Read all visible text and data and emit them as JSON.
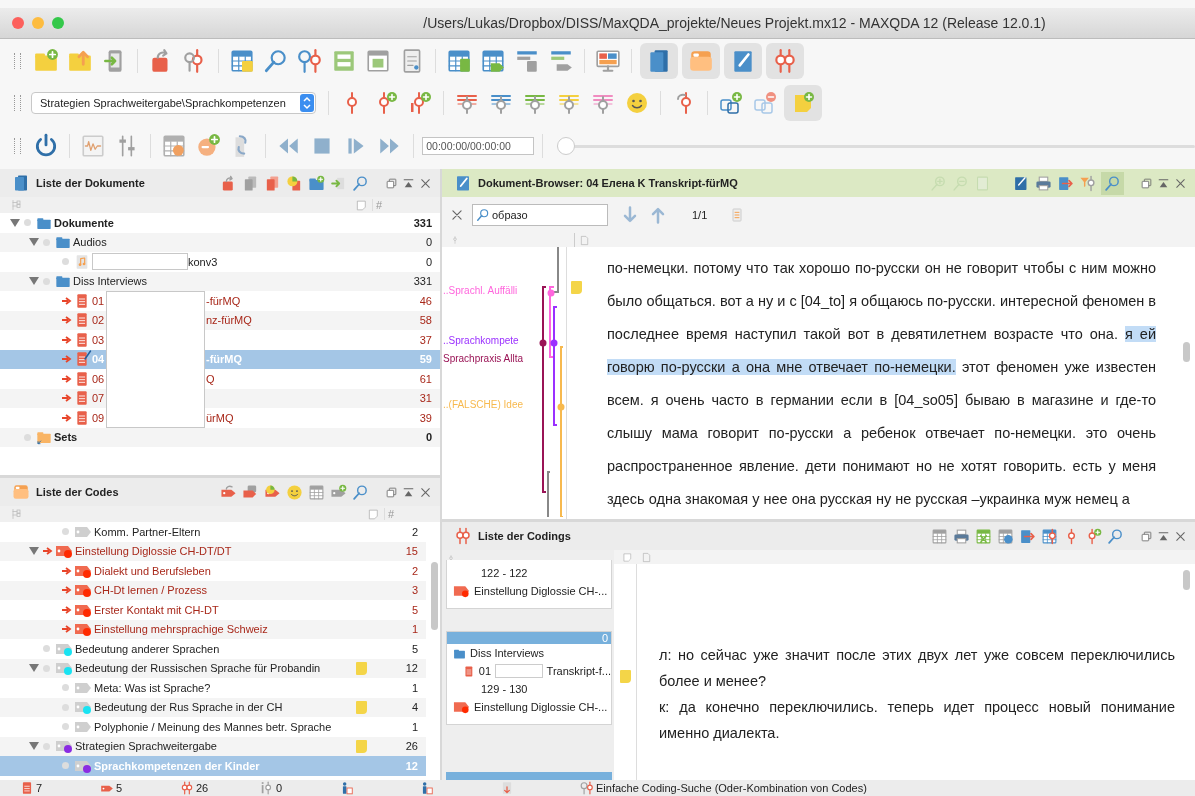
{
  "window": {
    "title": "/Users/Lukas/Dropbox/DISS/MaxQDA_projekte/Neues Projekt.mx12 - MAXQDA 12  (Release 12.0.1)"
  },
  "toolbar": {
    "panel_toggles": [
      {
        "selected": true
      },
      {
        "selected": true
      },
      {
        "selected": true
      },
      {
        "selected": true
      }
    ],
    "code_selector": "Strategien Sprachweitergabe\\Sprachkompetenzen",
    "memo_toggle": {
      "selected": true
    },
    "media_time": "00:00:00/00:00:00",
    "media_position": {
      "level": 0
    }
  },
  "documents": {
    "title": "Liste der Dokumente",
    "count_column": "#",
    "tree": [
      {
        "kind": "folder",
        "label": "Dokumente",
        "count": "331",
        "expanded": true,
        "selected": false,
        "children": [
          {
            "kind": "folder",
            "label": "Audios",
            "count": "0",
            "expanded": true,
            "selected": false,
            "children": [
              {
                "kind": "audio",
                "tail": "konv3",
                "count": "0",
                "selected": false
              }
            ]
          },
          {
            "kind": "folder",
            "label": "Diss Interviews",
            "count": "331",
            "expanded": true,
            "selected": false,
            "children": [
              {
                "kind": "text",
                "number": "01",
                "tail": "-fürMQ",
                "count": "46",
                "activated": true,
                "open": false,
                "selected": false
              },
              {
                "kind": "text",
                "number": "02",
                "tail": "nz-fürMQ",
                "count": "58",
                "activated": true,
                "open": false,
                "selected": false
              },
              {
                "kind": "text",
                "number": "03",
                "count": "37",
                "activated": true,
                "open": false,
                "selected": false
              },
              {
                "kind": "text",
                "number": "04",
                "tail": "-fürMQ",
                "count": "59",
                "activated": true,
                "open": true,
                "selected": true
              },
              {
                "kind": "text",
                "number": "06",
                "tail": "Q",
                "count": "61",
                "activated": true,
                "open": false,
                "selected": false
              },
              {
                "kind": "text",
                "number": "07",
                "count": "31",
                "activated": true,
                "open": false,
                "selected": false
              },
              {
                "kind": "text",
                "number": "09",
                "tail": "ürMQ",
                "count": "39",
                "activated": true,
                "open": false,
                "selected": false
              }
            ]
          }
        ]
      },
      {
        "kind": "set",
        "label": "Sets",
        "count": "0",
        "selected": false
      }
    ]
  },
  "codes": {
    "title": "Liste der Codes",
    "count_column": "#",
    "tree": [
      {
        "children": [
          {
            "label": "Komm. Partner-Eltern",
            "count": "2",
            "activated": false,
            "memo": false,
            "selected": false
          }
        ]
      },
      {
        "label": "Einstellung Diglossie CH-DT/DT",
        "count": "15",
        "color": "#ff2a00",
        "activated": true,
        "memo": false,
        "expanded": true,
        "selected": false,
        "children": [
          {
            "label": "Dialekt und Berufsleben",
            "count": "2",
            "color": "#ff2a00",
            "activated": true,
            "memo": false,
            "selected": false
          },
          {
            "label": "CH-Dt lernen / Prozess",
            "count": "3",
            "color": "#ff2a00",
            "activated": true,
            "memo": false,
            "selected": false
          },
          {
            "label": "Erster Kontakt mit CH-DT",
            "count": "5",
            "color": "#ff2a00",
            "activated": true,
            "memo": false,
            "selected": false
          },
          {
            "label": "Einstellung mehrsprachige Schweiz",
            "count": "1",
            "color": "#ff2a00",
            "activated": true,
            "memo": false,
            "selected": false
          }
        ]
      },
      {
        "label": "Bedeutung anderer Sprachen",
        "count": "5",
        "color": "#19e3f2",
        "activated": false,
        "memo": false,
        "selected": false
      },
      {
        "label": "Bedeutung der Russischen Sprache für Probandin",
        "count": "12",
        "color": "#19e3f2",
        "activated": false,
        "memo": true,
        "expanded": true,
        "selected": false,
        "children": [
          {
            "label": "Meta: Was ist Sprache?",
            "count": "1",
            "activated": false,
            "memo": false,
            "selected": false
          },
          {
            "label": "Bedeutung der Rus Sprache in der CH",
            "count": "4",
            "color": "#19e3f2",
            "activated": false,
            "memo": true,
            "selected": false
          },
          {
            "label": "Polyphonie / Meinung des Mannes betr. Sprache",
            "count": "1",
            "activated": false,
            "memo": false,
            "selected": false
          }
        ]
      },
      {
        "label": "Strategien Sprachweitergabe",
        "count": "26",
        "color": "#8a2be2",
        "activated": false,
        "memo": true,
        "expanded": true,
        "selected": false,
        "children": [
          {
            "label": "Sprachkompetenzen der Kinder",
            "count": "12",
            "color": "#8a2be2",
            "activated": false,
            "memo": false,
            "selected": true
          }
        ]
      }
    ]
  },
  "browser": {
    "title": "Dokument-Browser: 04 Елена K Transkript-fürMQ",
    "search": "образо",
    "hits": "1/1",
    "memo": true,
    "code_stripes": [
      {
        "label": "..Sprachl. Auffälli",
        "color": "#ff66dd"
      },
      {
        "label": "..Sprachkompete",
        "color": "#9b30ff"
      },
      {
        "label": "Sprachpraxis Allta",
        "color": "#9a1456"
      },
      {
        "label": "..(FALSCHE) Idee",
        "color": "#f7b94e"
      }
    ],
    "text_before": "по-немецки. потому что так хорошо по-русски он не говорит чтобы с ним можно было общаться. вот а ну и с [04_to] я общаюсь по-русски. интересной феномен в последнее время наступил такой вот в девятилетнем возрасте что она.",
    "highlight": "я ей говорю по-русски а она мне отвечает по-немецки.",
    "text_after": "этот феномен уже известен всем. я очень часто в германии если в [04_so05] бываю в магазине и где-то слышу мама говорит по-русски а ребенок отвечает по-немецки. это очень распространенное явление. дети понимают но не хотят говорить. есть у меня здесь одна знакомая у нее она русская ну не русская –украинка муж немец а"
  },
  "codings": {
    "title": "Liste der Codings",
    "memo": true,
    "cards": [
      {
        "range": "122 - 122",
        "code": "Einstellung Diglossie CH-..."
      },
      {
        "weight": "0",
        "folder": "Diss Interviews",
        "number": "01",
        "tail": "Transkript-f...",
        "range": "129 - 130",
        "code": "Einstellung Diglossie CH-..."
      }
    ],
    "segments": [
      "л: но сейчас уже значит после этих двух лет уже совсем переключились более и менее?",
      "к: да конечно переключились. теперь идет процесс новый   понимание именно диалекта."
    ]
  },
  "status_bar": {
    "counts": [
      "7",
      "5",
      "26",
      "0"
    ],
    "search_mode": "Einfache Coding-Suche (Oder-Kombination von Codes)"
  }
}
